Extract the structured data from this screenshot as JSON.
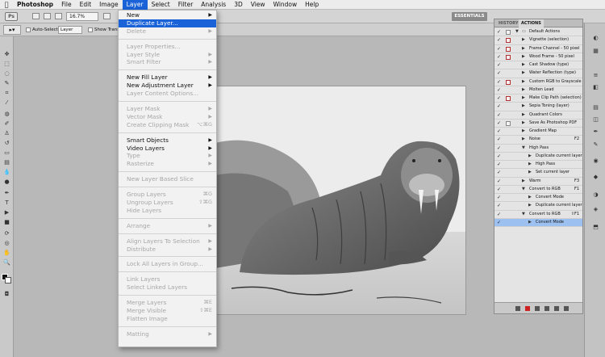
{
  "menubar": {
    "items": [
      "Photoshop",
      "File",
      "Edit",
      "Image",
      "Layer",
      "Select",
      "Filter",
      "Analysis",
      "3D",
      "View",
      "Window",
      "Help"
    ]
  },
  "app": {
    "logo": "Ps",
    "zoom": "16.7%",
    "workspace": "ESSENTIALS"
  },
  "options": {
    "auto_select_label": "Auto-Select:",
    "auto_select_value": "Layer",
    "show_transform_label": "Show Transfo"
  },
  "layer_menu": {
    "items": [
      {
        "label": "New",
        "arrow": "▶",
        "enabled": true
      },
      {
        "label": "Duplicate Layer...",
        "enabled": true,
        "highlight": true
      },
      {
        "label": "Delete",
        "arrow": "▶",
        "enabled": false
      },
      {
        "sep": true
      },
      {
        "label": "Layer Properties...",
        "enabled": false
      },
      {
        "label": "Layer Style",
        "arrow": "▶",
        "enabled": false
      },
      {
        "label": "Smart Filter",
        "arrow": "▶",
        "enabled": false
      },
      {
        "sep": true
      },
      {
        "label": "New Fill Layer",
        "arrow": "▶",
        "enabled": true
      },
      {
        "label": "New Adjustment Layer",
        "arrow": "▶",
        "enabled": true
      },
      {
        "label": "Layer Content Options...",
        "enabled": false
      },
      {
        "sep": true
      },
      {
        "label": "Layer Mask",
        "arrow": "▶",
        "enabled": false
      },
      {
        "label": "Vector Mask",
        "arrow": "▶",
        "enabled": false
      },
      {
        "label": "Create Clipping Mask",
        "shortcut": "⌥⌘G",
        "enabled": false
      },
      {
        "sep": true
      },
      {
        "label": "Smart Objects",
        "arrow": "▶",
        "enabled": true
      },
      {
        "label": "Video Layers",
        "arrow": "▶",
        "enabled": true
      },
      {
        "label": "Type",
        "arrow": "▶",
        "enabled": false
      },
      {
        "label": "Rasterize",
        "arrow": "▶",
        "enabled": false
      },
      {
        "sep": true
      },
      {
        "label": "New Layer Based Slice",
        "enabled": false
      },
      {
        "sep": true
      },
      {
        "label": "Group Layers",
        "shortcut": "⌘G",
        "enabled": false
      },
      {
        "label": "Ungroup Layers",
        "shortcut": "⇧⌘G",
        "enabled": false
      },
      {
        "label": "Hide Layers",
        "enabled": false
      },
      {
        "sep": true
      },
      {
        "label": "Arrange",
        "arrow": "▶",
        "enabled": false
      },
      {
        "sep": true
      },
      {
        "label": "Align Layers To Selection",
        "arrow": "▶",
        "enabled": false
      },
      {
        "label": "Distribute",
        "arrow": "▶",
        "enabled": false
      },
      {
        "sep": true
      },
      {
        "label": "Lock All Layers in Group...",
        "enabled": false
      },
      {
        "sep": true
      },
      {
        "label": "Link Layers",
        "enabled": false
      },
      {
        "label": "Select Linked Layers",
        "enabled": false
      },
      {
        "sep": true
      },
      {
        "label": "Merge Layers",
        "shortcut": "⌘E",
        "enabled": false
      },
      {
        "label": "Merge Visible",
        "shortcut": "⇧⌘E",
        "enabled": false
      },
      {
        "label": "Flatten Image",
        "enabled": false
      },
      {
        "sep": true
      },
      {
        "label": "Matting",
        "arrow": "▶",
        "enabled": false
      }
    ]
  },
  "actions_panel": {
    "tabs": [
      "HISTORY",
      "ACTIONS"
    ],
    "active_tab": "ACTIONS",
    "rows": [
      {
        "label": "Default Actions",
        "level": 0,
        "open": true,
        "folder": true
      },
      {
        "label": "Vignette (selection)",
        "level": 1,
        "red": true
      },
      {
        "label": "Frame Channel - 50 pixel",
        "level": 1,
        "red": true
      },
      {
        "label": "Wood Frame - 50 pixel",
        "level": 1,
        "red": true
      },
      {
        "label": "Cast Shadow (type)",
        "level": 1
      },
      {
        "label": "Water Reflection (type)",
        "level": 1
      },
      {
        "label": "Custom RGB to Grayscale",
        "level": 1,
        "red": true
      },
      {
        "label": "Molten Lead",
        "level": 1
      },
      {
        "label": "Make Clip Path (selection)",
        "level": 1,
        "red": true
      },
      {
        "label": "Sepia Toning (layer)",
        "level": 1
      },
      {
        "label": "Quadrant Colors",
        "level": 1
      },
      {
        "label": "Save As Photoshop PDF",
        "level": 1,
        "dlg": true
      },
      {
        "label": "Gradient Map",
        "level": 1
      },
      {
        "label": "Noise",
        "level": 1,
        "shortcut": "F2"
      },
      {
        "label": "High Pass",
        "level": 1,
        "open": true
      },
      {
        "label": "Duplicate current layer",
        "level": 2
      },
      {
        "label": "High Pass",
        "level": 2
      },
      {
        "label": "Set current layer",
        "level": 2
      },
      {
        "label": "Warm",
        "level": 1,
        "shortcut": "F3"
      },
      {
        "label": "Convert to RGB",
        "level": 1,
        "open": true,
        "shortcut": "F1"
      },
      {
        "label": "Convert Mode",
        "level": 2
      },
      {
        "label": "Duplicate current layer",
        "level": 2
      },
      {
        "label": "Convert to RGB",
        "level": 1,
        "open": true,
        "shortcut": "⇧F1"
      },
      {
        "label": "Convert Mode",
        "level": 2,
        "selected": true
      }
    ]
  },
  "colors": {
    "menu_highlight": "#1a62d8",
    "action_selected": "#9cc0ef"
  }
}
